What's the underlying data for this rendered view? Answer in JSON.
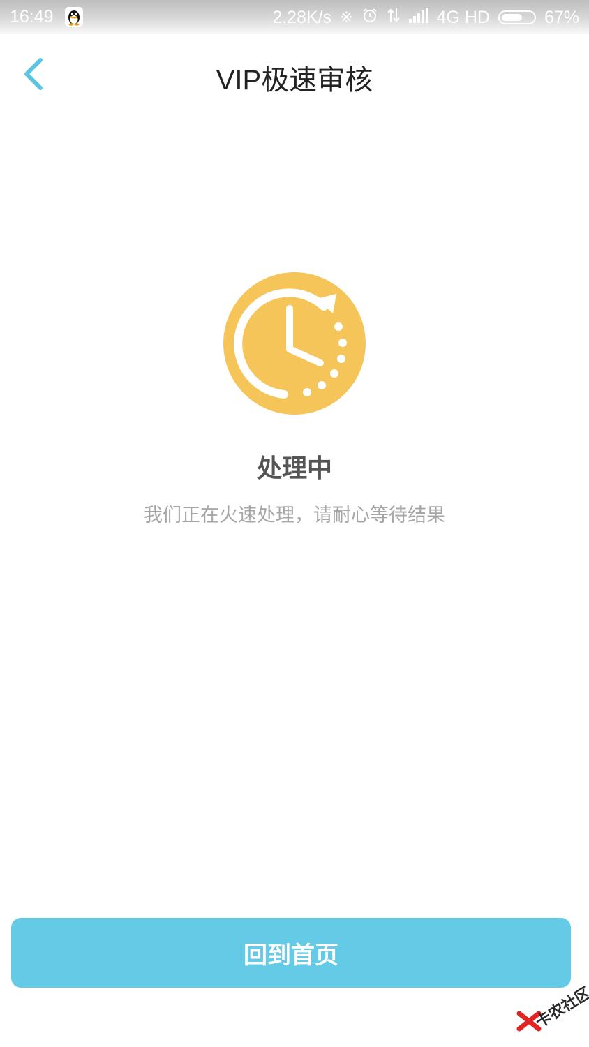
{
  "status_bar": {
    "time": "16:49",
    "network_speed": "2.28K/s",
    "network_type": "4G HD",
    "battery_percent": "67%",
    "battery_level": 0.67,
    "icons": [
      "qq-icon",
      "bluetooth-icon",
      "alarm-icon",
      "data-transfer-icon",
      "signal-icon",
      "battery-icon"
    ]
  },
  "nav": {
    "title": "VIP极速审核",
    "back_icon": "chevron-left-icon"
  },
  "status": {
    "icon": "clock-refresh-icon",
    "title": "处理中",
    "description": "我们正在火速处理，请耐心等待结果"
  },
  "actions": {
    "home_label": "回到首页"
  },
  "watermark": {
    "text": "卡农社区"
  },
  "colors": {
    "accent": "#64cae6",
    "back_icon": "#5bc4e3",
    "status_icon": "#f6c55a",
    "title_text": "#222222",
    "status_title": "#555555",
    "description_text": "#a6a6a6"
  }
}
